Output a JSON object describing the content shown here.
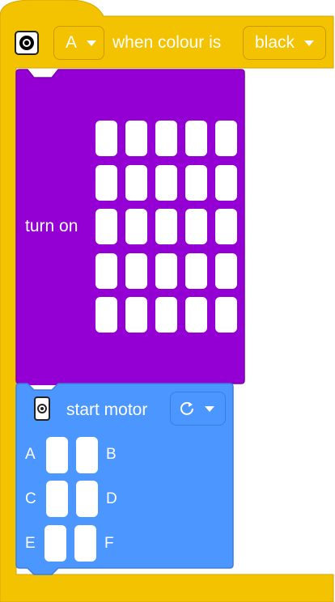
{
  "hat_block": {
    "color": "#f3c200",
    "icon": "colour-sensor-icon",
    "port_dropdown": "A",
    "label": "when colour is",
    "colour_dropdown": "black"
  },
  "light_block": {
    "color": "#9400d3",
    "label": "turn on",
    "matrix": {
      "rows": 5,
      "cols": 5,
      "lit": []
    }
  },
  "motor_block": {
    "color": "#4c97ff",
    "icon": "motor-icon",
    "label": "start motor",
    "direction_dropdown_icon": "clockwise-arrow-icon",
    "ports": [
      "A",
      "B",
      "C",
      "D",
      "E",
      "F"
    ]
  }
}
